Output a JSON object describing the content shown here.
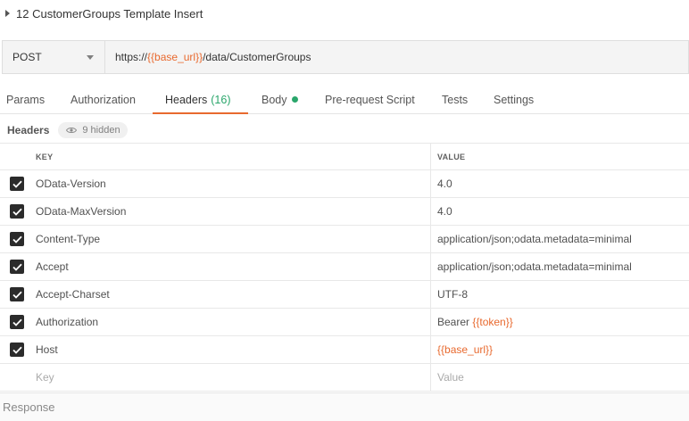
{
  "request": {
    "title": "12 CustomerGroups Template Insert",
    "method": "POST",
    "url": {
      "prefix": "https://",
      "variable": "{{base_url}}",
      "suffix": "/data/CustomerGroups"
    }
  },
  "tabs": [
    {
      "label": "Params"
    },
    {
      "label": "Authorization"
    },
    {
      "label": "Headers",
      "count": "(16)"
    },
    {
      "label": "Body"
    },
    {
      "label": "Pre-request Script"
    },
    {
      "label": "Tests"
    },
    {
      "label": "Settings"
    }
  ],
  "active_tab": "Headers",
  "headers_section": {
    "label": "Headers",
    "hidden_text": "9 hidden"
  },
  "table": {
    "columns": {
      "key": "KEY",
      "value": "VALUE"
    },
    "rows": [
      {
        "key": "OData-Version",
        "value": "4.0",
        "checked": true
      },
      {
        "key": "OData-MaxVersion",
        "value": "4.0",
        "checked": true
      },
      {
        "key": "Content-Type",
        "value": "application/json;odata.metadata=minimal",
        "checked": true
      },
      {
        "key": "Accept",
        "value": "application/json;odata.metadata=minimal",
        "checked": true
      },
      {
        "key": "Accept-Charset",
        "value": "UTF-8",
        "checked": true
      },
      {
        "key": "Authorization",
        "value_prefix": "Bearer ",
        "value_var": "{{token}}",
        "checked": true
      },
      {
        "key": "Host",
        "value_var": "{{base_url}}",
        "checked": true
      }
    ],
    "new_row": {
      "key_placeholder": "Key",
      "value_placeholder": "Value"
    }
  },
  "response": {
    "label": "Response"
  },
  "colors": {
    "accent": "#e8692e",
    "count_green": "#2aa66b",
    "checkbox": "#2b2b2b"
  },
  "icons": {
    "title_caret": "caret-right-icon",
    "method_dropdown": "chevron-down-icon",
    "hidden_eye": "eye-icon",
    "body_indicator": "dot-icon",
    "row_check": "check-icon"
  }
}
